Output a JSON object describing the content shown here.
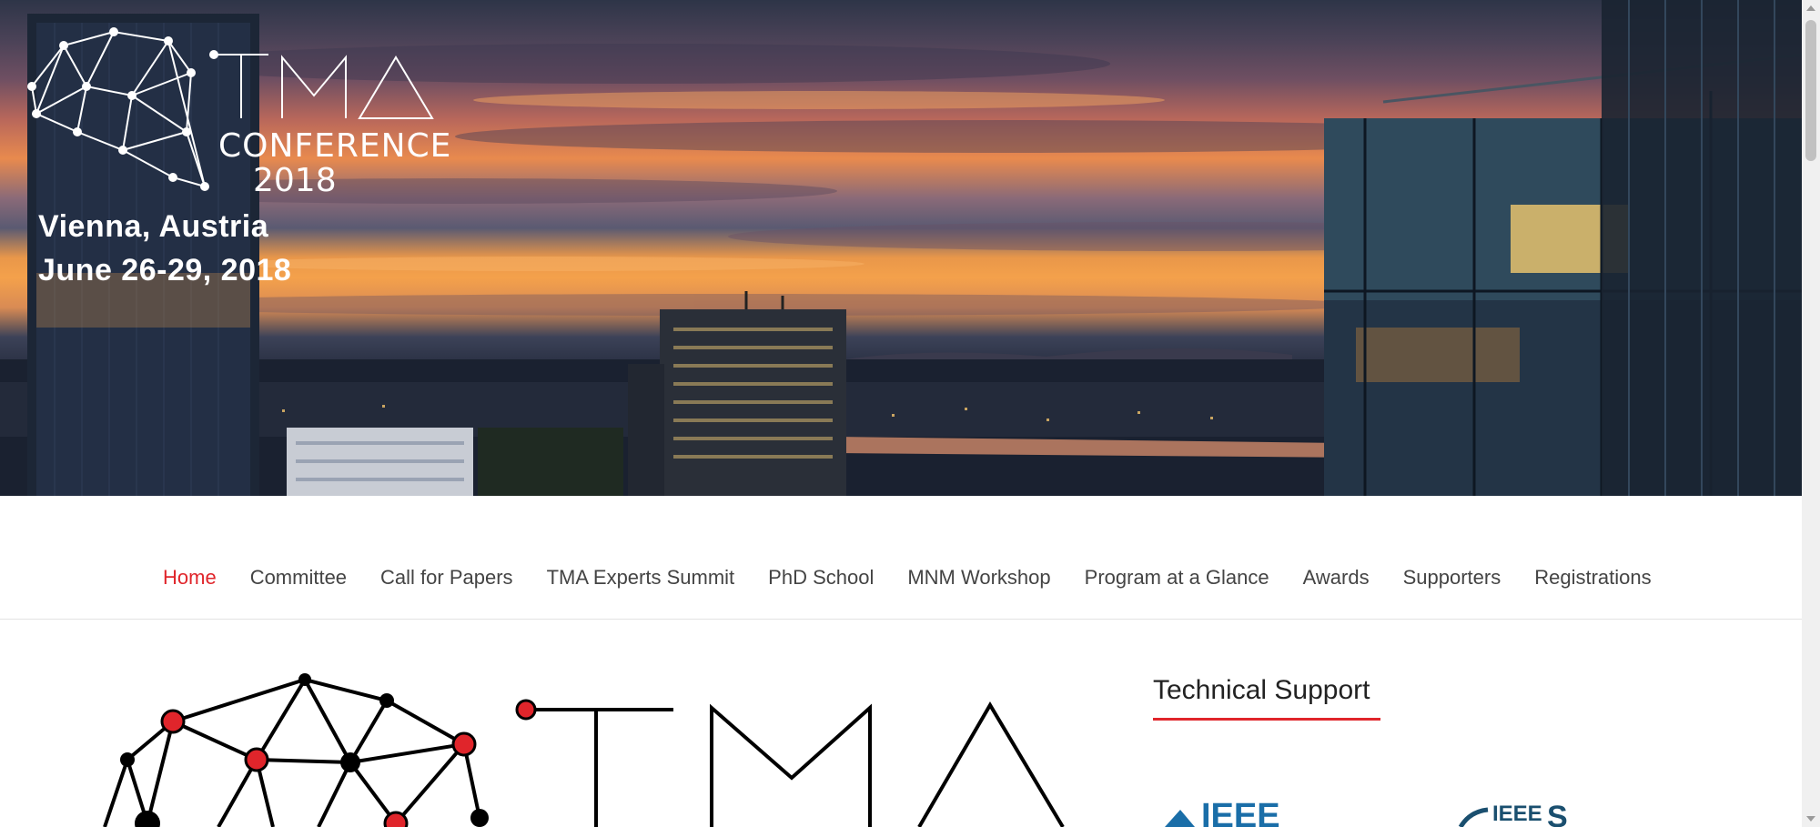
{
  "hero": {
    "logo_letters": "TMA",
    "logo_conference": "CONFERENCE",
    "logo_year": "2018",
    "location": "Vienna, Austria",
    "dates": "June 26-29, 2018"
  },
  "nav": {
    "items": [
      {
        "label": "Home",
        "active": true
      },
      {
        "label": "Committee",
        "active": false
      },
      {
        "label": "Call for Papers",
        "active": false
      },
      {
        "label": "TMA Experts Summit",
        "active": false
      },
      {
        "label": "PhD School",
        "active": false
      },
      {
        "label": "MNM Workshop",
        "active": false
      },
      {
        "label": "Program at a Glance",
        "active": false
      },
      {
        "label": "Awards",
        "active": false
      },
      {
        "label": "Supporters",
        "active": false
      },
      {
        "label": "Registrations",
        "active": false
      }
    ]
  },
  "main": {
    "logo_letters": "TMA"
  },
  "sidebar": {
    "title": "Technical Support",
    "logo1_text": "IEEE",
    "logo2_text": "IEEE"
  },
  "colors": {
    "accent": "#e0252b",
    "nav_text": "#444444"
  }
}
